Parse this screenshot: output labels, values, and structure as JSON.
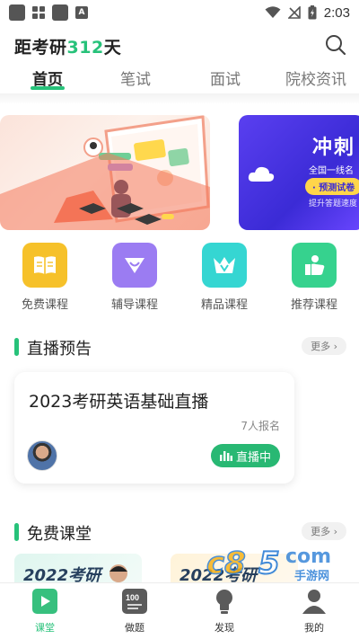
{
  "status_bar": {
    "time": "2:03"
  },
  "header": {
    "title_prefix": "距考研",
    "days_number": "312",
    "title_suffix": "天"
  },
  "tabs": [
    {
      "label": "首页",
      "active": true
    },
    {
      "label": "笔试",
      "active": false
    },
    {
      "label": "面试",
      "active": false
    },
    {
      "label": "院校资讯",
      "active": false
    }
  ],
  "banner_secondary": {
    "title": "冲刺",
    "subtitle": "全国一线名",
    "pill": "· 预测试卷",
    "note": "提升答题速度"
  },
  "categories": [
    {
      "label": "免费课程",
      "color": "#f6c12a",
      "icon": "book-icon"
    },
    {
      "label": "辅导课程",
      "color": "#9b7cf2",
      "icon": "heart-diamond-icon"
    },
    {
      "label": "精品课程",
      "color": "#35d6d2",
      "icon": "crown-icon"
    },
    {
      "label": "推荐课程",
      "color": "#36d28e",
      "icon": "thumbs-up-icon"
    }
  ],
  "live_section": {
    "title": "直播预告",
    "more": "更多 ›",
    "card": {
      "title": "2023考研英语基础直播",
      "count": "7人报名",
      "badge": "直播中"
    }
  },
  "free_section": {
    "title": "免费课堂",
    "more": "更多 ›",
    "cards": [
      {
        "title": "2022考研"
      },
      {
        "title": "2022考研"
      }
    ]
  },
  "bottom_nav": [
    {
      "label": "课堂",
      "active": true,
      "icon": "play-icon"
    },
    {
      "label": "做题",
      "active": false,
      "icon": "exam-paper-icon"
    },
    {
      "label": "发现",
      "active": false,
      "icon": "lightbulb-icon"
    },
    {
      "label": "我的",
      "active": false,
      "icon": "user-icon"
    }
  ],
  "watermark": {
    "text": "手游网"
  },
  "colors": {
    "accent": "#27c27a",
    "live_badge": "#28b873",
    "banner_purple": "#4a34e8"
  }
}
